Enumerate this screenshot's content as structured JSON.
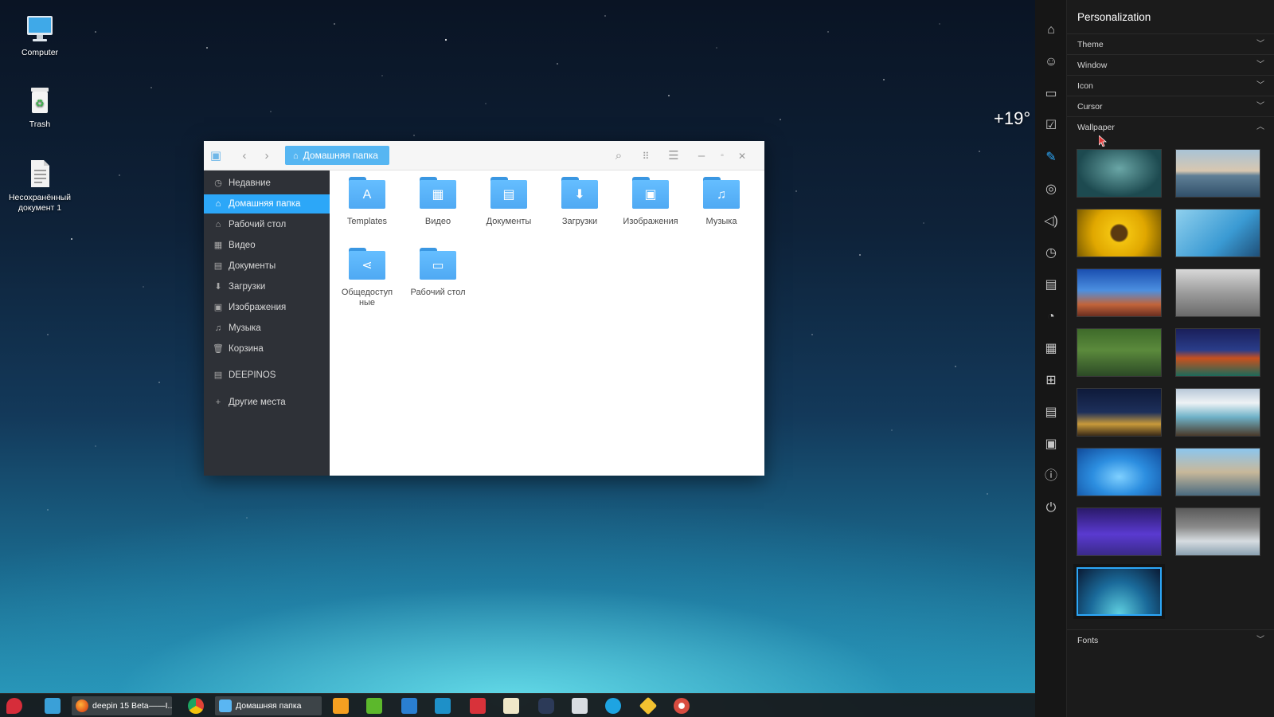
{
  "desktop": {
    "icons": [
      {
        "label": "Computer",
        "icon": "computer-icon"
      },
      {
        "label": "Trash",
        "icon": "trash-icon"
      },
      {
        "label": "Несохранённый документ 1",
        "icon": "document-icon"
      }
    ],
    "weather": "+19°"
  },
  "file_manager": {
    "breadcrumb": "Домашняя папка",
    "sidebar": [
      {
        "label": "Недавние",
        "icon": "clock-icon"
      },
      {
        "label": "Домашняя папка",
        "icon": "home-icon",
        "active": true
      },
      {
        "label": "Рабочий стол",
        "icon": "desktop-icon"
      },
      {
        "label": "Видео",
        "icon": "video-icon"
      },
      {
        "label": "Документы",
        "icon": "documents-icon"
      },
      {
        "label": "Загрузки",
        "icon": "download-icon"
      },
      {
        "label": "Изображения",
        "icon": "image-icon"
      },
      {
        "label": "Музыка",
        "icon": "music-icon"
      },
      {
        "label": "Корзина",
        "icon": "trash-icon"
      },
      {
        "label": "DEEPINOS",
        "icon": "drive-icon"
      },
      {
        "label": "Другие места",
        "icon": "plus-icon"
      }
    ],
    "folders": [
      {
        "label": "Templates",
        "icon": "template-icon"
      },
      {
        "label": "Видео",
        "icon": "video-icon"
      },
      {
        "label": "Документы",
        "icon": "documents-icon"
      },
      {
        "label": "Загрузки",
        "icon": "download-icon"
      },
      {
        "label": "Изображения",
        "icon": "image-icon"
      },
      {
        "label": "Музыка",
        "icon": "music-icon"
      },
      {
        "label": "Общедоступные",
        "icon": "share-icon"
      },
      {
        "label": "Рабочий стол",
        "icon": "desktop-icon"
      }
    ]
  },
  "personalization": {
    "title": "Personalization",
    "sections": {
      "theme": "Theme",
      "window": "Window",
      "icon": "Icon",
      "cursor": "Cursor",
      "wallpaper": "Wallpaper",
      "fonts": "Fonts"
    },
    "selected_wallpaper_index": 12
  },
  "taskbar": {
    "windows": [
      {
        "label": "deepin 15 Beta——I...",
        "icon": "firefox-icon"
      },
      {
        "label": "Домашняя папка",
        "icon": "file-manager-icon"
      }
    ]
  },
  "colors": {
    "accent": "#2ca7f8",
    "folder": "#56b6f2",
    "sidebar_bg": "#2e3137",
    "panel_bg": "#1b1b1b"
  }
}
